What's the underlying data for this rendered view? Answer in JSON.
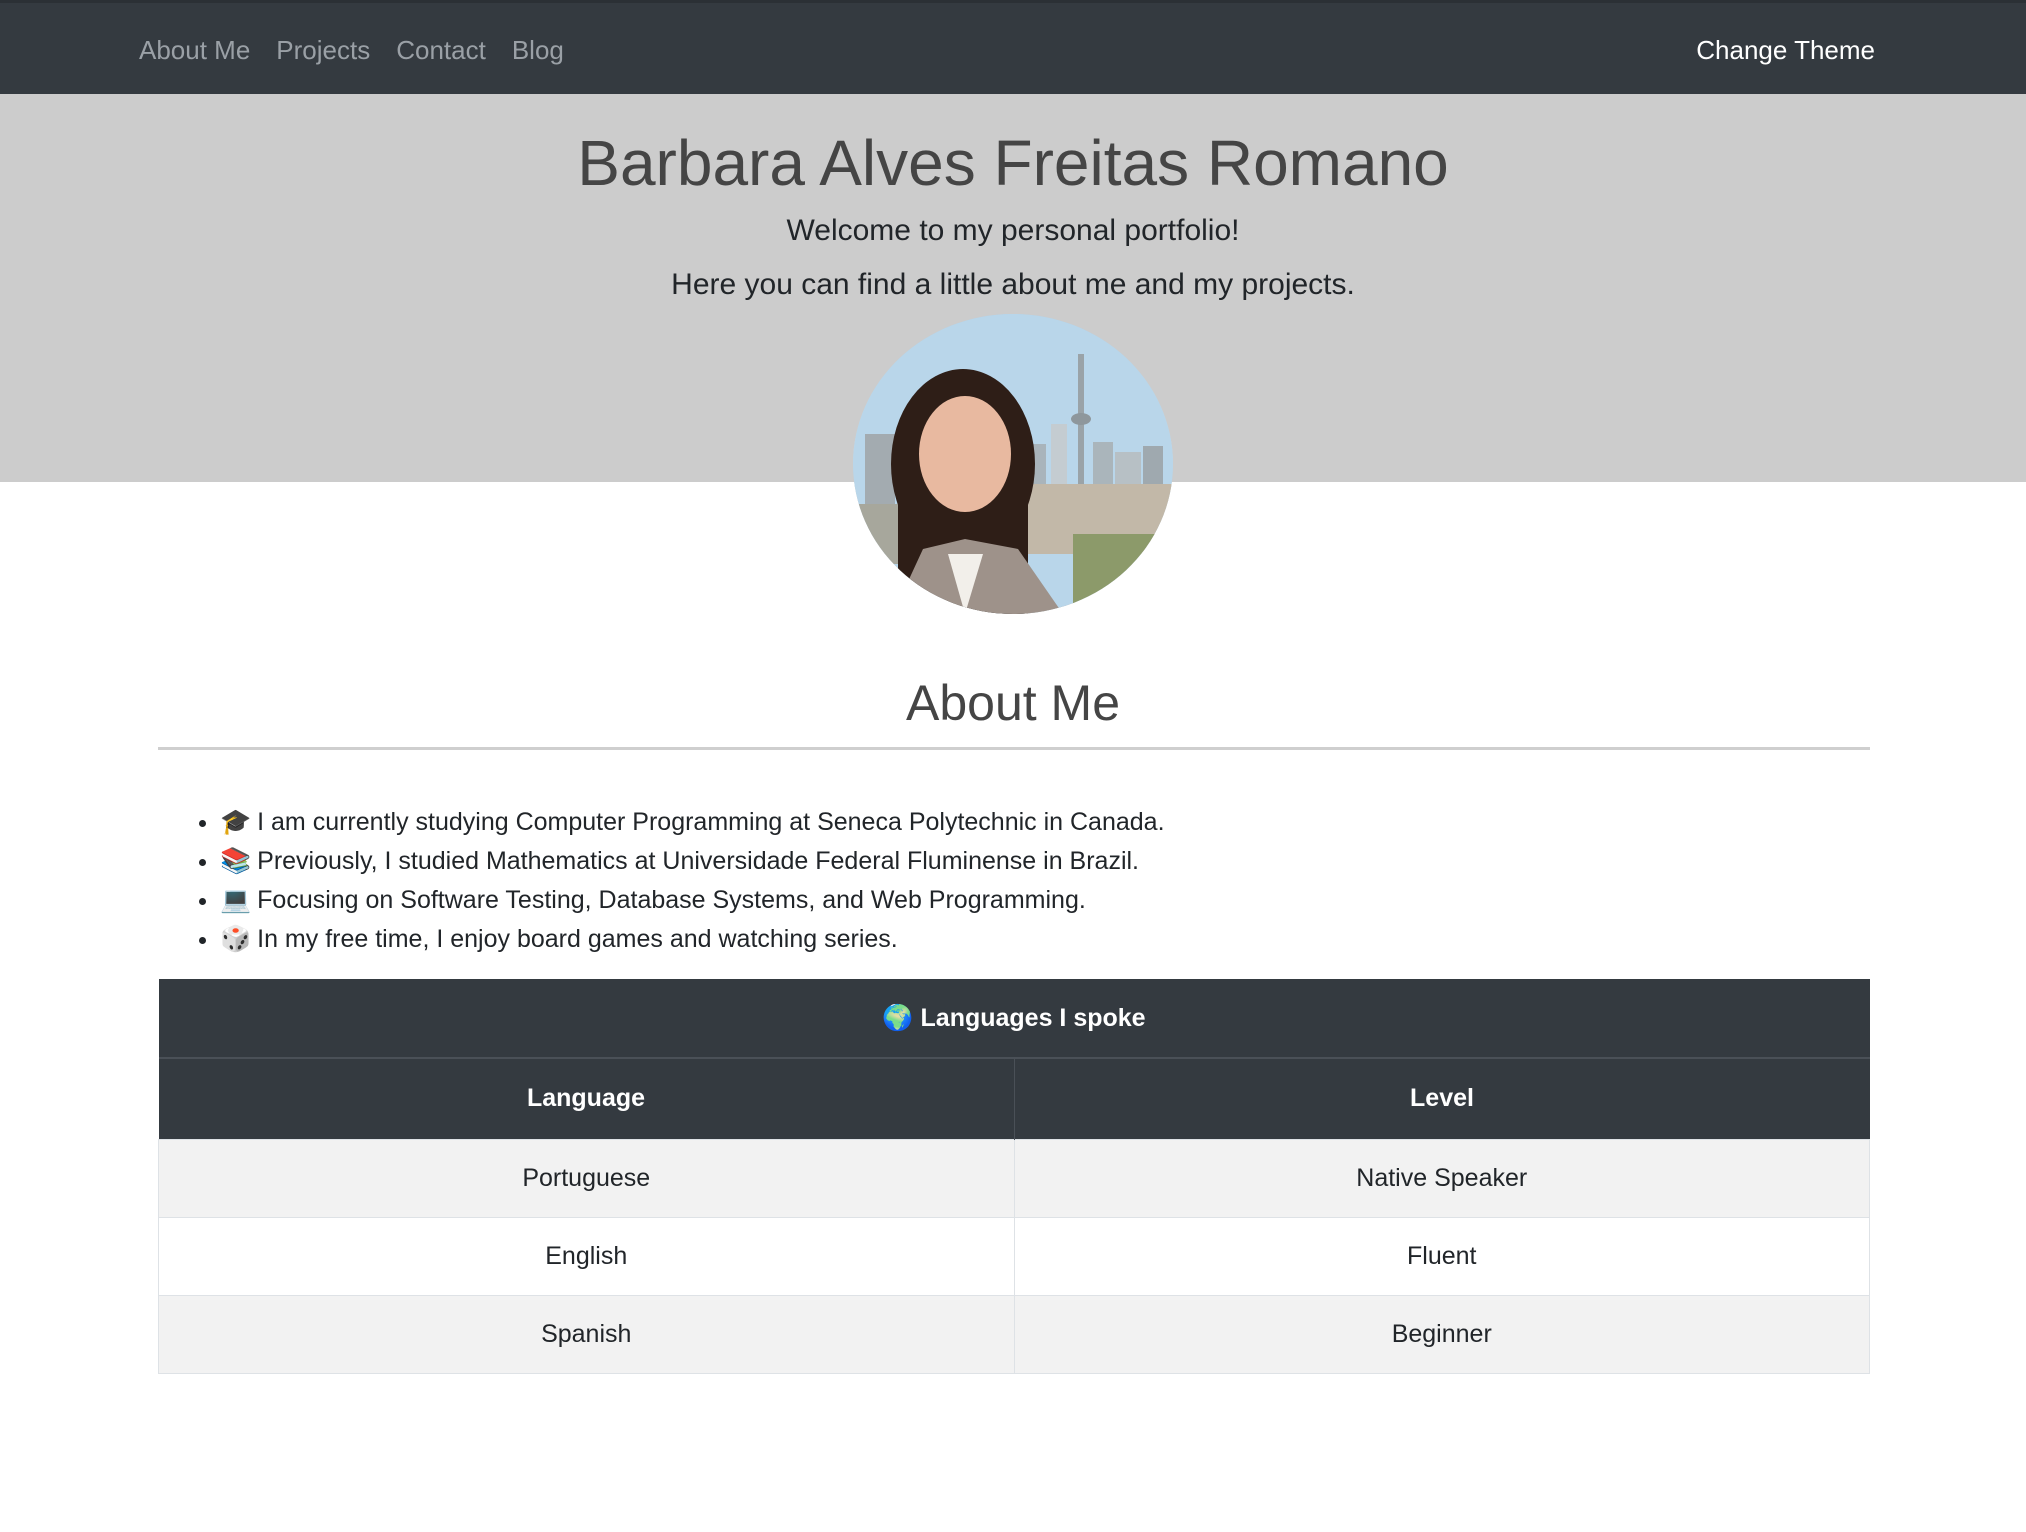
{
  "nav": {
    "links": [
      "About Me",
      "Projects",
      "Contact",
      "Blog"
    ],
    "theme_button": "Change Theme"
  },
  "header": {
    "name": "Barbara Alves Freitas Romano",
    "welcome": "Welcome to my personal portfolio!",
    "tagline": "Here you can find a little about me and my projects."
  },
  "about": {
    "title": "About Me",
    "items": [
      {
        "icon": "🎓",
        "icon_name": "graduation-cap-icon",
        "text": "I am currently studying Computer Programming at Seneca Polytechnic in Canada."
      },
      {
        "icon": "📚",
        "icon_name": "books-icon",
        "text": "Previously, I studied Mathematics at Universidade Federal Fluminense in Brazil."
      },
      {
        "icon": "💻",
        "icon_name": "laptop-icon",
        "text": "Focusing on Software Testing, Database Systems, and Web Programming."
      },
      {
        "icon": "🎲",
        "icon_name": "dice-icon",
        "text": "In my free time, I enjoy board games and watching series."
      }
    ]
  },
  "languages": {
    "caption_icon": "🌍",
    "caption": "Languages I spoke",
    "columns": [
      "Language",
      "Level"
    ],
    "rows": [
      [
        "Portuguese",
        "Native Speaker"
      ],
      [
        "English",
        "Fluent"
      ],
      [
        "Spanish",
        "Beginner"
      ]
    ]
  },
  "colors": {
    "navbar": "#343a40",
    "header_bg": "#cccccc",
    "table_head": "#343a40",
    "striped_row": "#f2f2f2"
  }
}
